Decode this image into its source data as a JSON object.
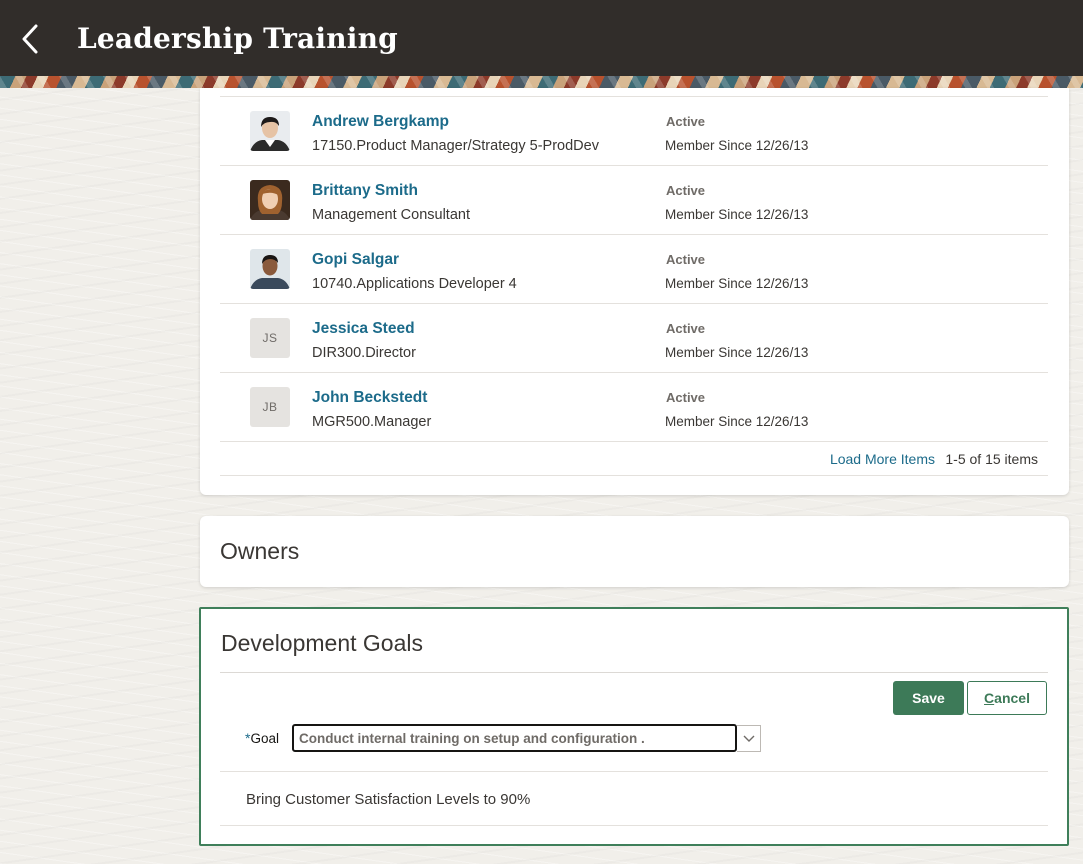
{
  "header": {
    "title": "Leadership Training",
    "back_icon": "chevron-left-icon"
  },
  "members": {
    "items": [
      {
        "name": "Andrew Bergkamp",
        "job": "17150.Product Manager/Strategy 5-ProdDev",
        "status": "Active",
        "since": "Member Since 12/26/13",
        "avatar_type": "photo",
        "initials": ""
      },
      {
        "name": "Brittany Smith",
        "job": "Management Consultant",
        "status": "Active",
        "since": "Member Since 12/26/13",
        "avatar_type": "photo",
        "initials": ""
      },
      {
        "name": "Gopi Salgar",
        "job": "10740.Applications Developer 4",
        "status": "Active",
        "since": "Member Since 12/26/13",
        "avatar_type": "photo",
        "initials": ""
      },
      {
        "name": "Jessica Steed",
        "job": "DIR300.Director",
        "status": "Active",
        "since": "Member Since 12/26/13",
        "avatar_type": "initials",
        "initials": "JS"
      },
      {
        "name": "John Beckstedt",
        "job": "MGR500.Manager",
        "status": "Active",
        "since": "Member Since 12/26/13",
        "avatar_type": "initials",
        "initials": "JB"
      }
    ],
    "load_more_label": "Load More Items",
    "count_label": "1-5 of 15 items"
  },
  "owners": {
    "title": "Owners"
  },
  "goals": {
    "title": "Development Goals",
    "save_label": "Save",
    "cancel_label_first": "C",
    "cancel_label_rest": "ancel",
    "required_marker": "*",
    "goal_label": "Goal",
    "goal_value": "Conduct internal training on setup and configuration .",
    "existing_goal": "Bring Customer Satisfaction Levels to 90%"
  },
  "colors": {
    "header_bg": "#312d2a",
    "link": "#1c6b8a",
    "primary_button": "#3d7a58",
    "focus_border": "#3f7f5a"
  }
}
